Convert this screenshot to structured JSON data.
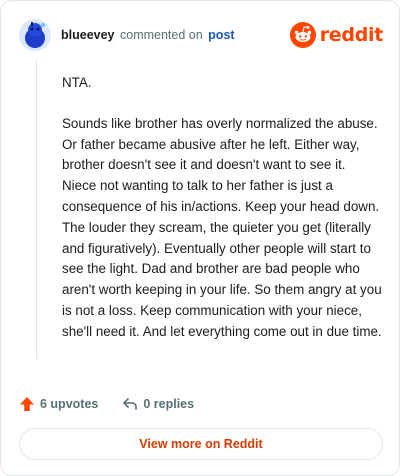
{
  "header": {
    "username": "blueevey",
    "action_text": "commented on",
    "post_link": "post",
    "brand": "reddit"
  },
  "comment": {
    "paragraphs": [
      "NTA.",
      "Sounds like brother has overly normalized the abuse. Or father became abusive after he left. Either way, brother doesn't see it and doesn't want to see it. Niece not wanting to talk to her father is just a consequence of his in/actions. Keep your head down. The louder they scream, the quieter you get (literally and figuratively). Eventually other people will start to see the light. Dad and brother are bad people who aren't worth keeping in your life. So them angry at you is not a loss. Keep communication with your niece, she'll need it. And let everything come out in due time."
    ]
  },
  "actions": {
    "upvotes": "6 upvotes",
    "replies": "0 replies"
  },
  "footer": {
    "view_more": "View more on Reddit"
  },
  "colors": {
    "brand": "#ff4500",
    "link": "#1a58b4",
    "upvote": "#ff4500",
    "view_more": "#d93a00"
  }
}
